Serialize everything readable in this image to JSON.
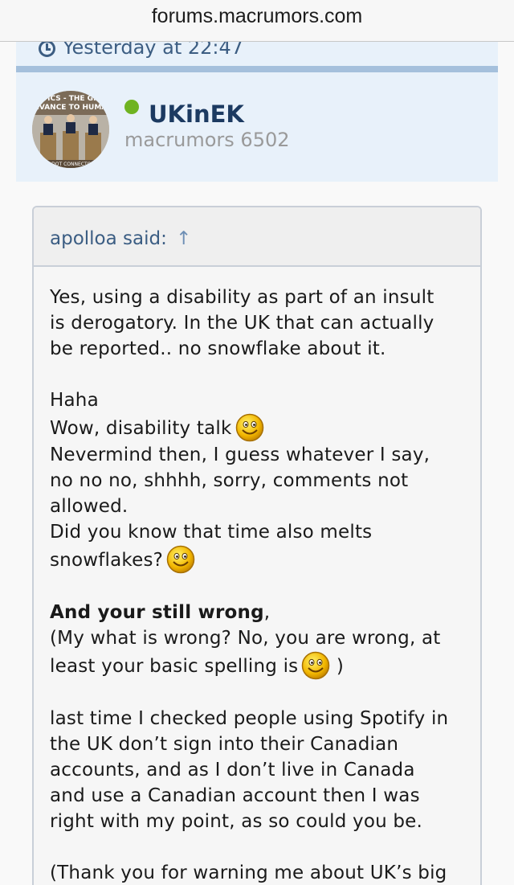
{
  "browser": {
    "url": "forums.macrumors.com"
  },
  "previous_post": {
    "timestamp": "Yesterday at 22:47"
  },
  "post_author": {
    "username": "UKinEK",
    "title": "macrumors 6502",
    "online": true,
    "avatar_text_top": "TICS - THE GR\nEVANCE TO HUMA",
    "avatar_text_bottom": "E DOT CONNECTOR"
  },
  "quote": {
    "attribution": "apolloa said:",
    "jump_arrow": "↑",
    "p1": [
      "Yes, using a disability as part of an insult",
      "is derogatory. In the UK that can actually",
      "be reported.. no snowflake about it."
    ],
    "p2_line1": "Haha",
    "p2_line2": "Wow, disability talk",
    "p2_line3": "Nevermind then, I guess whatever I say,",
    "p2_line4": "no no no, shhhh, sorry, comments not",
    "p2_line5": "allowed.",
    "p2_line6": "Did you know that time also melts",
    "p2_line7": "snowflakes?",
    "p3_bold": "And your still wrong",
    "p3_comma": ",",
    "p3_line2": "(My what is wrong? No, you are wrong, at",
    "p3_line3": "least your basic spelling is",
    "p3_line3_end": " )",
    "p4": [
      "last time I checked people using Spotify in",
      "the UK don’t sign into their Canadian",
      "accounts, and as I don’t live in Canada",
      "and use a Canadian account then I was",
      "right with my point, as so could you be."
    ],
    "p5_line1": "(Thank you for warning me about UK’s big",
    "smiley_icon": "smile-emoji"
  },
  "colors": {
    "accent": "#1c3a61",
    "online": "#6fb321",
    "meta_bg": "#e8f1fa",
    "separator": "#a5c0dc"
  }
}
